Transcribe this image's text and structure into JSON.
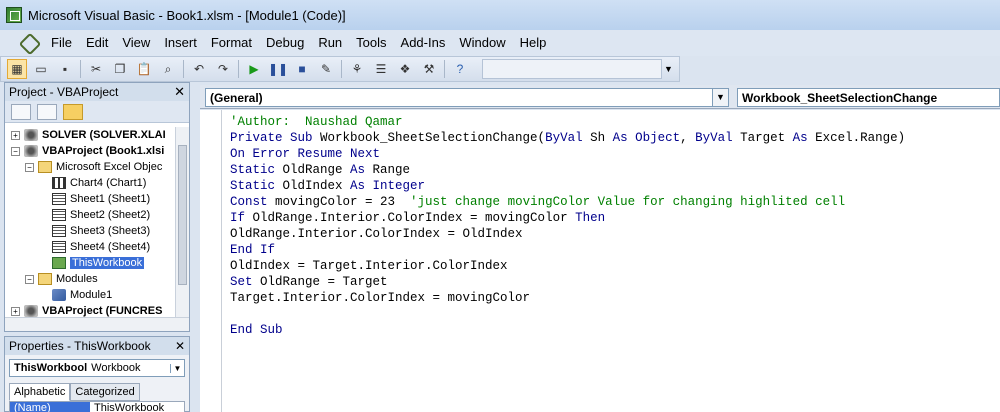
{
  "window": {
    "title": "Microsoft Visual Basic - Book1.xlsm - [Module1 (Code)]"
  },
  "menu": [
    "File",
    "Edit",
    "View",
    "Insert",
    "Format",
    "Debug",
    "Run",
    "Tools",
    "Add-Ins",
    "Window",
    "Help"
  ],
  "toolbar": {
    "icons": [
      "excel-view-icon",
      "insert-userform-icon",
      "save-icon",
      "cut-icon",
      "copy-icon",
      "paste-icon",
      "find-icon",
      "undo-icon",
      "redo-icon",
      "run-icon",
      "break-icon",
      "reset-icon",
      "design-mode-icon",
      "project-explorer-icon",
      "properties-icon",
      "object-browser-icon",
      "toolbox-icon",
      "help-icon"
    ]
  },
  "project_panel": {
    "title": "Project - VBAProject",
    "tree": [
      {
        "label": "SOLVER (SOLVER.XLAI",
        "level": 0,
        "expander": "+",
        "icon": "vba",
        "bold": true
      },
      {
        "label": "VBAProject (Book1.xlsi",
        "level": 0,
        "expander": "−",
        "icon": "vba",
        "bold": true
      },
      {
        "label": "Microsoft Excel Objec",
        "level": 1,
        "expander": "−",
        "icon": "folder",
        "bold": false
      },
      {
        "label": "Chart4 (Chart1)",
        "level": 2,
        "expander": "",
        "icon": "chart",
        "bold": false
      },
      {
        "label": "Sheet1 (Sheet1)",
        "level": 2,
        "expander": "",
        "icon": "sheet",
        "bold": false
      },
      {
        "label": "Sheet2 (Sheet2)",
        "level": 2,
        "expander": "",
        "icon": "sheet",
        "bold": false
      },
      {
        "label": "Sheet3 (Sheet3)",
        "level": 2,
        "expander": "",
        "icon": "sheet",
        "bold": false
      },
      {
        "label": "Sheet4 (Sheet4)",
        "level": 2,
        "expander": "",
        "icon": "sheet",
        "bold": false
      },
      {
        "label": "ThisWorkbook",
        "level": 2,
        "expander": "",
        "icon": "wb",
        "bold": false,
        "selected": true
      },
      {
        "label": "Modules",
        "level": 1,
        "expander": "−",
        "icon": "folder",
        "bold": false
      },
      {
        "label": "Module1",
        "level": 2,
        "expander": "",
        "icon": "mod",
        "bold": false
      },
      {
        "label": "VBAProject (FUNCRES",
        "level": 0,
        "expander": "+",
        "icon": "vba",
        "bold": true
      }
    ]
  },
  "properties_panel": {
    "title": "Properties - ThisWorkbook",
    "object_name": "ThisWorkbool",
    "object_type": "Workbook",
    "tabs": [
      "Alphabetic",
      "Categorized"
    ],
    "row": {
      "key": "(Name)",
      "value": "ThisWorkbook"
    }
  },
  "code_window": {
    "object_combo": "(General)",
    "procedure_combo": "Workbook_SheetSelectionChange",
    "lines": [
      [
        [
          "cm",
          "'Author:  Naushad Qamar"
        ]
      ],
      [
        [
          "kw",
          "Private Sub "
        ],
        [
          "tx",
          "Workbook_SheetSelectionChange("
        ],
        [
          "kw",
          "ByVal "
        ],
        [
          "tx",
          "Sh "
        ],
        [
          "kw",
          "As Object"
        ],
        [
          "tx",
          ", "
        ],
        [
          "kw",
          "ByVal "
        ],
        [
          "tx",
          "Target "
        ],
        [
          "kw",
          "As "
        ],
        [
          "tx",
          "Excel.Range)"
        ]
      ],
      [
        [
          "kw",
          "On Error Resume Next"
        ]
      ],
      [
        [
          "kw",
          "Static "
        ],
        [
          "tx",
          "OldRange "
        ],
        [
          "kw",
          "As "
        ],
        [
          "tx",
          "Range"
        ]
      ],
      [
        [
          "kw",
          "Static "
        ],
        [
          "tx",
          "OldIndex "
        ],
        [
          "kw",
          "As Integer"
        ]
      ],
      [
        [
          "kw",
          "Const "
        ],
        [
          "tx",
          "movingColor = 23  "
        ],
        [
          "cm",
          "'just change movingColor Value for changing highlited cell"
        ]
      ],
      [
        [
          "kw",
          "If "
        ],
        [
          "tx",
          "OldRange.Interior.ColorIndex = movingColor "
        ],
        [
          "kw",
          "Then"
        ]
      ],
      [
        [
          "tx",
          "OldRange.Interior.ColorIndex = OldIndex"
        ]
      ],
      [
        [
          "kw",
          "End If"
        ]
      ],
      [
        [
          "tx",
          "OldIndex = Target.Interior.ColorIndex"
        ]
      ],
      [
        [
          "kw",
          "Set "
        ],
        [
          "tx",
          "OldRange = Target"
        ]
      ],
      [
        [
          "tx",
          "Target.Interior.ColorIndex = movingColor"
        ]
      ],
      [
        [
          "tx",
          ""
        ]
      ],
      [
        [
          "kw",
          "End Sub"
        ]
      ]
    ]
  }
}
